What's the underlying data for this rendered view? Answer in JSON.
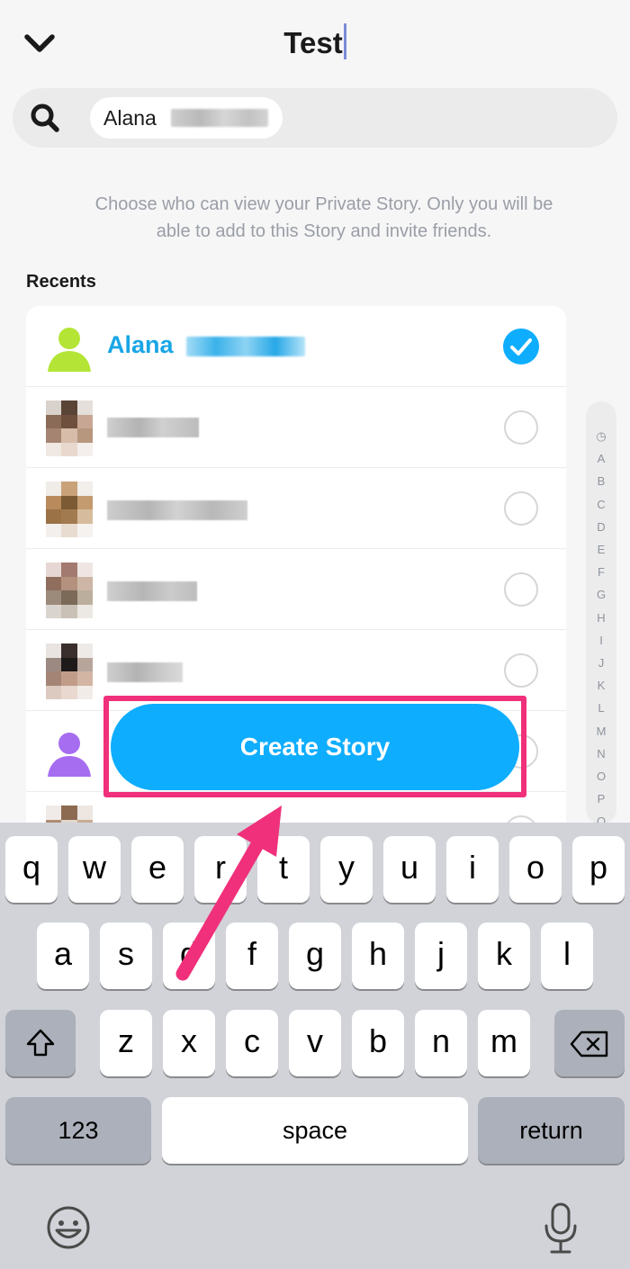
{
  "header": {
    "title": "Test"
  },
  "search": {
    "chip_text": "Alana"
  },
  "helper_text": "Choose who can view your Private Story. Only you will be able to add to this Story and invite friends.",
  "recents_label": "Recents",
  "list": {
    "selected_first_name": "Alana",
    "rows": [
      {
        "selected": true
      },
      {
        "selected": false
      },
      {
        "selected": false
      },
      {
        "selected": false
      },
      {
        "selected": false
      },
      {
        "selected": false
      },
      {
        "selected": false
      }
    ]
  },
  "alpha_index": [
    "◷",
    "A",
    "B",
    "C",
    "D",
    "E",
    "F",
    "G",
    "H",
    "I",
    "J",
    "K",
    "L",
    "M",
    "N",
    "O",
    "P",
    "Q"
  ],
  "create_story_label": "Create Story",
  "keyboard": {
    "row1": [
      "q",
      "w",
      "e",
      "r",
      "t",
      "y",
      "u",
      "i",
      "o",
      "p"
    ],
    "row2": [
      "a",
      "s",
      "d",
      "f",
      "g",
      "h",
      "j",
      "k",
      "l"
    ],
    "row3": [
      "z",
      "x",
      "c",
      "v",
      "b",
      "n",
      "m"
    ],
    "numbers_label": "123",
    "space_label": "space",
    "return_label": "return"
  },
  "colors": {
    "accent": "#0fadfe",
    "highlight": "#f0307a",
    "selected_name": "#19a6e6"
  },
  "icons": [
    "chevron-down-icon",
    "search-icon",
    "check-icon",
    "shift-icon",
    "backspace-icon",
    "emoji-icon",
    "microphone-icon"
  ]
}
